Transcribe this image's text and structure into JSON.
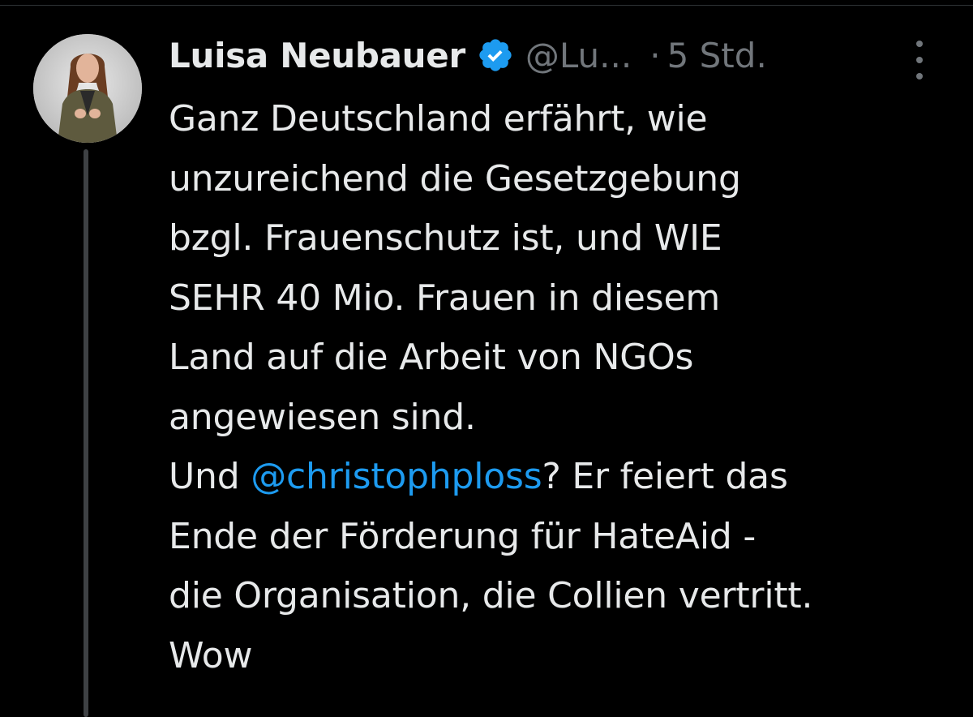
{
  "tweet": {
    "display_name": "Luisa Neubauer",
    "handle": "@Lu...",
    "separator": "·",
    "time": "5 Std.",
    "body_lines": {
      "l1": "Ganz Deutschland erfährt, wie",
      "l2": "unzureichend die Gesetzgebung",
      "l3": "bzgl. Frauenschutz ist, und WIE",
      "l4": "SEHR 40 Mio. Frauen in diesem",
      "l5": "Land auf die Arbeit von NGOs",
      "l6": "angewiesen sind.",
      "l7_prefix": "Und ",
      "l7_mention": "@christophploss",
      "l7_suffix": "? Er feiert das",
      "l8": "Ende der Förderung für HateAid -",
      "l9": "die Organisation, die Collien vertritt.",
      "l10": "Wow"
    },
    "icons": {
      "verified": "verified-badge-icon",
      "more": "more-options-icon",
      "avatar": "profile-avatar"
    },
    "colors": {
      "background": "#000000",
      "text": "#e7e9ea",
      "secondary": "#71767b",
      "mention": "#1d9bf0",
      "verified": "#1d9bf0"
    }
  }
}
